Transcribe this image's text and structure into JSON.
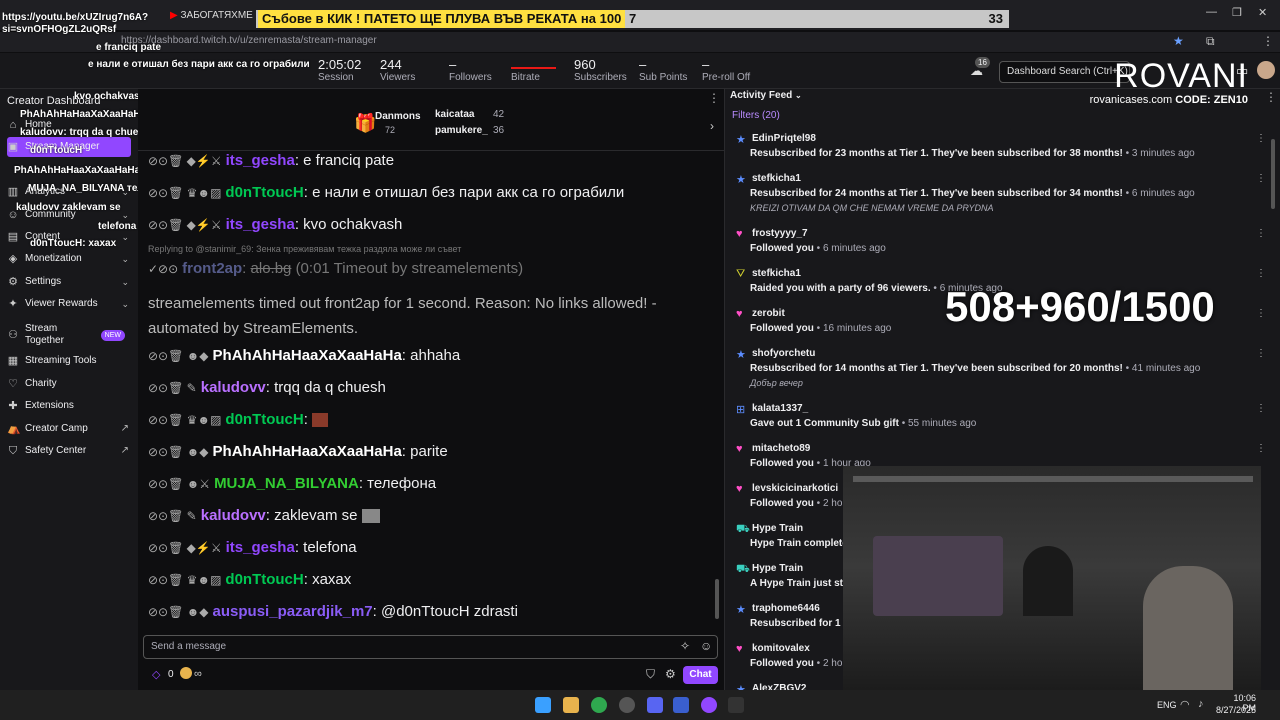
{
  "browser": {
    "tab_url_left": "https://youtu.be/xUZIrug7n6A?si=svnOFHOgZL2uQRsf",
    "tab_title": "ЗАБОГАТЯХМЕ В",
    "banner_text": "Събове в КИК ! ПАТЕТО ЩЕ ПЛУВА ВЪВ РЕКАТА на 100",
    "banner_num1": "7",
    "banner_num2": "33",
    "url": "https://dashboard.twitch.tv/u/zenremasta/stream-manager"
  },
  "stats": [
    {
      "value": "2:05:02",
      "label": "Session"
    },
    {
      "value": "244",
      "label": "Viewers"
    },
    {
      "value": "–",
      "label": "Followers"
    },
    {
      "value": "",
      "label": "Bitrate"
    },
    {
      "value": "960",
      "label": "Subscribers"
    },
    {
      "value": "–",
      "label": "Sub Points"
    },
    {
      "value": "–",
      "label": "Pre-roll Off"
    }
  ],
  "topbar": {
    "notif_count": "16",
    "search_placeholder": "Dashboard Search (Ctrl+K)"
  },
  "sidebar": {
    "title": "Creator Dashboard",
    "items": [
      {
        "label": "Home"
      },
      {
        "label": "Stream Manager"
      },
      {
        "label": "Analytics"
      },
      {
        "label": "Community"
      },
      {
        "label": "Content"
      },
      {
        "label": "Monetization"
      },
      {
        "label": "Settings"
      },
      {
        "label": "Viewer Rewards"
      },
      {
        "label": "Stream Together",
        "badge": "NEW"
      },
      {
        "label": "Streaming Tools"
      },
      {
        "label": "Charity"
      },
      {
        "label": "Extensions"
      },
      {
        "label": "Creator Camp"
      },
      {
        "label": "Safety Center"
      }
    ]
  },
  "overlay_chat": [
    {
      "text": "e franciq pate"
    },
    {
      "text": "е нали е отишал без пари акк са го ограбили"
    },
    {
      "text": "kvo ochakvash"
    },
    {
      "text": "PhAhAhHaHaaXaXaaHaHa ahhaha"
    },
    {
      "text": "kaludovv: trqq da q chuesh"
    },
    {
      "text": "d0nTtoucH"
    },
    {
      "text": "PhAhAhHaHaaXaXaaHaHa: parite"
    },
    {
      "text": "MUJA_NA_BILYANA телефона"
    },
    {
      "text": "kaludovv zaklevam se"
    },
    {
      "text": "telefona"
    },
    {
      "text": "d0nTtoucH: xaxax"
    }
  ],
  "pinned": {
    "leader1": "Danmons",
    "leader1_count": "72",
    "leader2": "kaicataa",
    "leader2_count": "42",
    "leader3": "pamukere_",
    "leader3_count": "36"
  },
  "chat": {
    "messages": [
      {
        "user": "its_gesha",
        "text": "e franciq pate"
      },
      {
        "user": "d0nTtoucH",
        "text": "е нали е отишал без пари акк са го ограбили"
      },
      {
        "user": "its_gesha",
        "text": "kvo ochakvash"
      },
      {
        "reply": "Replying to @stanimir_69: Зенка преживявам тежка раздяла може ли съвет"
      },
      {
        "user": "front2ap",
        "strike": "alo.bg",
        "text": "(0:01 Timeout by streamelements)"
      },
      {
        "system": "streamelements timed out front2ap for 1 second. Reason: No links allowed! - automated by StreamElements."
      },
      {
        "user": "PhAhAhHaHaaXaXaaHaHa",
        "text": "ahhaha"
      },
      {
        "user": "kaludovv",
        "text": "trqq da q chuesh"
      },
      {
        "user": "d0nTtoucH",
        "text": ""
      },
      {
        "user": "PhAhAhHaHaaXaXaaHaHa",
        "text": "parite"
      },
      {
        "user": "MUJA_NA_BILYANA",
        "text": "телефона"
      },
      {
        "user": "kaludovv",
        "text": "zaklevam se"
      },
      {
        "user": "its_gesha",
        "text": "telefona"
      },
      {
        "user": "d0nTtoucH",
        "text": "xaxax"
      },
      {
        "user": "auspusi_pazardjik_m7",
        "text": "@d0nTtoucH zdrasti"
      }
    ],
    "input_placeholder": "Send a message",
    "points": "0",
    "chat_button": "Chat"
  },
  "feed": {
    "title": "Activity Feed",
    "filters": "Filters (20)",
    "items": [
      {
        "name": "EdinPriqtel98",
        "desc": "Resubscribed for 23 months at Tier 1. They've been subscribed for 38 months!",
        "time": "3 minutes ago"
      },
      {
        "name": "stefkicha1",
        "desc": "Resubscribed for 24 months at Tier 1. They've been subscribed for 34 months!",
        "time": "6 minutes ago",
        "msg": "KREIZI OTIVAM DA QM CHE NEMAM VREME DA PRYDNA"
      },
      {
        "name": "frostyyyy_7",
        "desc": "Followed you",
        "time": "6 minutes ago"
      },
      {
        "name": "stefkicha1",
        "desc": "Raided you with a party of 96 viewers.",
        "time": "6 minutes ago"
      },
      {
        "name": "zerobit",
        "desc": "Followed you",
        "time": "16 minutes ago"
      },
      {
        "name": "shofyorchetu",
        "desc": "Resubscribed for 14 months at Tier 1. They've been subscribed for 20 months!",
        "time": "41 minutes ago",
        "msg": "Добър вечер"
      },
      {
        "name": "kalata1337_",
        "desc": "Gave out 1 Community Sub gift",
        "time": "55 minutes ago"
      },
      {
        "name": "mitacheto89",
        "desc": "Followed you",
        "time": "1 hour ago"
      },
      {
        "name": "levskicicinarkotici",
        "desc": "Followed you",
        "time": "2 hours ago"
      },
      {
        "name": "Hype Train",
        "desc": "Hype Train complete a",
        "time": ""
      },
      {
        "name": "Hype Train",
        "desc": "A Hype Train just start",
        "time": ""
      },
      {
        "name": "traphome6446",
        "desc": "Resubscribed for 1 mo",
        "time": ""
      },
      {
        "name": "komitovalex",
        "desc": "Followed you",
        "time": "2 hours ago"
      },
      {
        "name": "AlexZBGV2",
        "desc": "",
        "time": ""
      }
    ]
  },
  "overlays": {
    "goal": "508+960/1500",
    "brand": "ROVANI",
    "brand_site": "rovanicases.com",
    "brand_code": "CODE: ZEN10"
  },
  "taskbar": {
    "lang": "ENG",
    "time": "10:06 PM",
    "date": "8/27/2025"
  },
  "colors": {
    "accent": "#9147ff",
    "banner_yellow": "#ffe040"
  }
}
